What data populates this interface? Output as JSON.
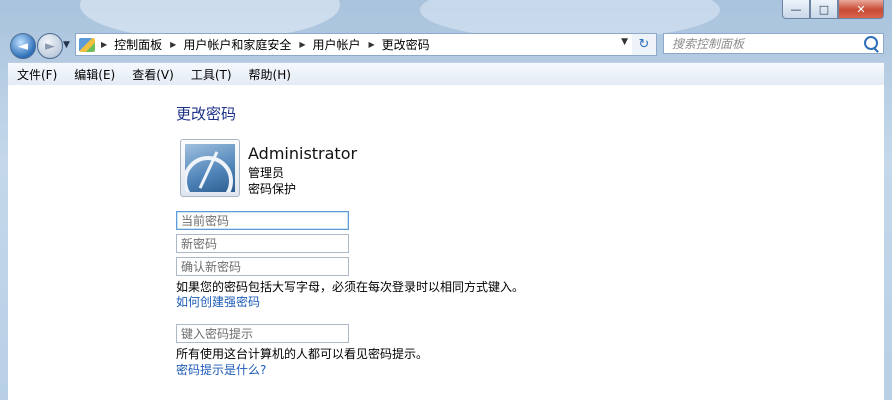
{
  "window": {
    "minimize_label": "—",
    "maximize_label": "□",
    "close_label": "✕"
  },
  "nav": {
    "back_glyph": "◄",
    "forward_glyph": "►",
    "history_glyph": "▼",
    "breadcrumbs": [
      "控制面板",
      "用户帐户和家庭安全",
      "用户帐户",
      "更改密码"
    ],
    "refresh_glyph": "↻",
    "search_placeholder": "搜索控制面板"
  },
  "menu": {
    "items": [
      "文件(F)",
      "编辑(E)",
      "查看(V)",
      "工具(T)",
      "帮助(H)"
    ]
  },
  "page": {
    "title": "更改密码",
    "user": {
      "name": "Administrator",
      "role": "管理员",
      "status": "密码保护"
    },
    "fields": {
      "current_password_placeholder": "当前密码",
      "new_password_placeholder": "新密码",
      "confirm_password_placeholder": "确认新密码",
      "hint_placeholder": "键入密码提示"
    },
    "caps_note": "如果您的密码包括大写字母，必须在每次登录时以相同方式键入。",
    "strong_password_link": "如何创建强密码",
    "hint_note": "所有使用这台计算机的人都可以看见密码提示。",
    "hint_link": "密码提示是什么?"
  }
}
